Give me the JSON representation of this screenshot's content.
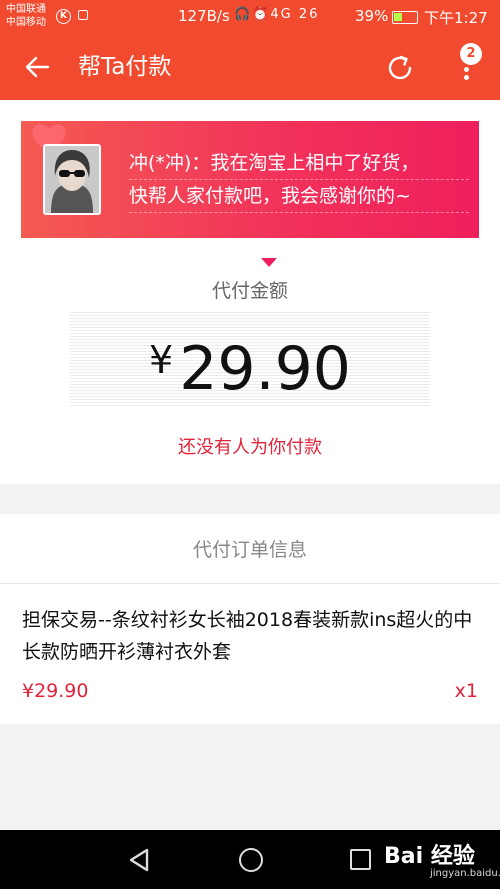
{
  "statusbar": {
    "carrier1": "中国联通",
    "carrier2": "中国移动",
    "net_speed": "127B/s",
    "signal": "4G 26",
    "battery": "39%",
    "battery_level": 0.39,
    "time": "下午1:27"
  },
  "appbar": {
    "title": "帮Ta付款",
    "notification_count": "2"
  },
  "request": {
    "message_line1": "冲(*冲)：我在淘宝上相中了好货，",
    "message_line2": "快帮人家付款吧，我会感谢你的~",
    "amount_label": "代付金额",
    "currency": "¥",
    "amount": "29.90",
    "status": "还没有人为你付款"
  },
  "order": {
    "header": "代付订单信息",
    "item_title": "担保交易--条纹衬衫女长袖2018春装新款ins超火的中长款防晒开衫薄衬衣外套",
    "item_price": "¥29.90",
    "item_qty": "x1"
  },
  "watermark": {
    "logo": "Bai 经验",
    "site": "jingyan.baidu.com"
  },
  "colors": {
    "brand": "#f24a2e",
    "accent_red": "#e2243a",
    "banner_end": "#ef1f5c"
  }
}
